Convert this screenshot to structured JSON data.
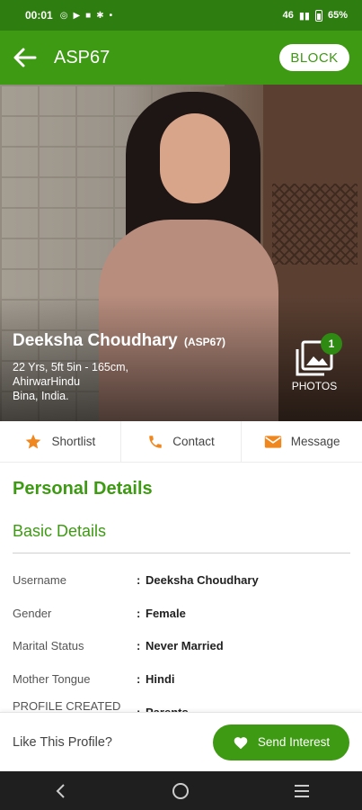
{
  "status_bar": {
    "time": "00:01",
    "signal": "46",
    "battery": "65%"
  },
  "app_bar": {
    "title": "ASP67",
    "block_label": "BLOCK"
  },
  "profile": {
    "name": "Deeksha  Choudhary",
    "id_tag": "(ASP67)",
    "line1": "22 Yrs, 5ft 5in - 165cm,",
    "line2": "AhirwarHindu",
    "line3": "Bina, India.",
    "photos_label": "PHOTOS",
    "photos_count": "1"
  },
  "actions": [
    {
      "label": "Shortlist",
      "icon": "star-icon"
    },
    {
      "label": "Contact",
      "icon": "phone-icon"
    },
    {
      "label": "Message",
      "icon": "mail-icon"
    }
  ],
  "section_title": "Personal Details",
  "sub_title": "Basic Details",
  "details": [
    {
      "key": "Username",
      "value": "Deeksha  Choudhary"
    },
    {
      "key": "Gender",
      "value": "Female"
    },
    {
      "key": "Marital Status",
      "value": "Never Married"
    },
    {
      "key": "Mother Tongue",
      "value": "Hindi"
    },
    {
      "key": "PROFILE CREATED BY",
      "value": "Parents"
    }
  ],
  "bottom": {
    "like_text": "Like This Profile?",
    "send_label": "Send Interest"
  },
  "colors": {
    "primary": "#3d9a12",
    "status_bar": "#2e7d10",
    "star": "#f0871e"
  }
}
